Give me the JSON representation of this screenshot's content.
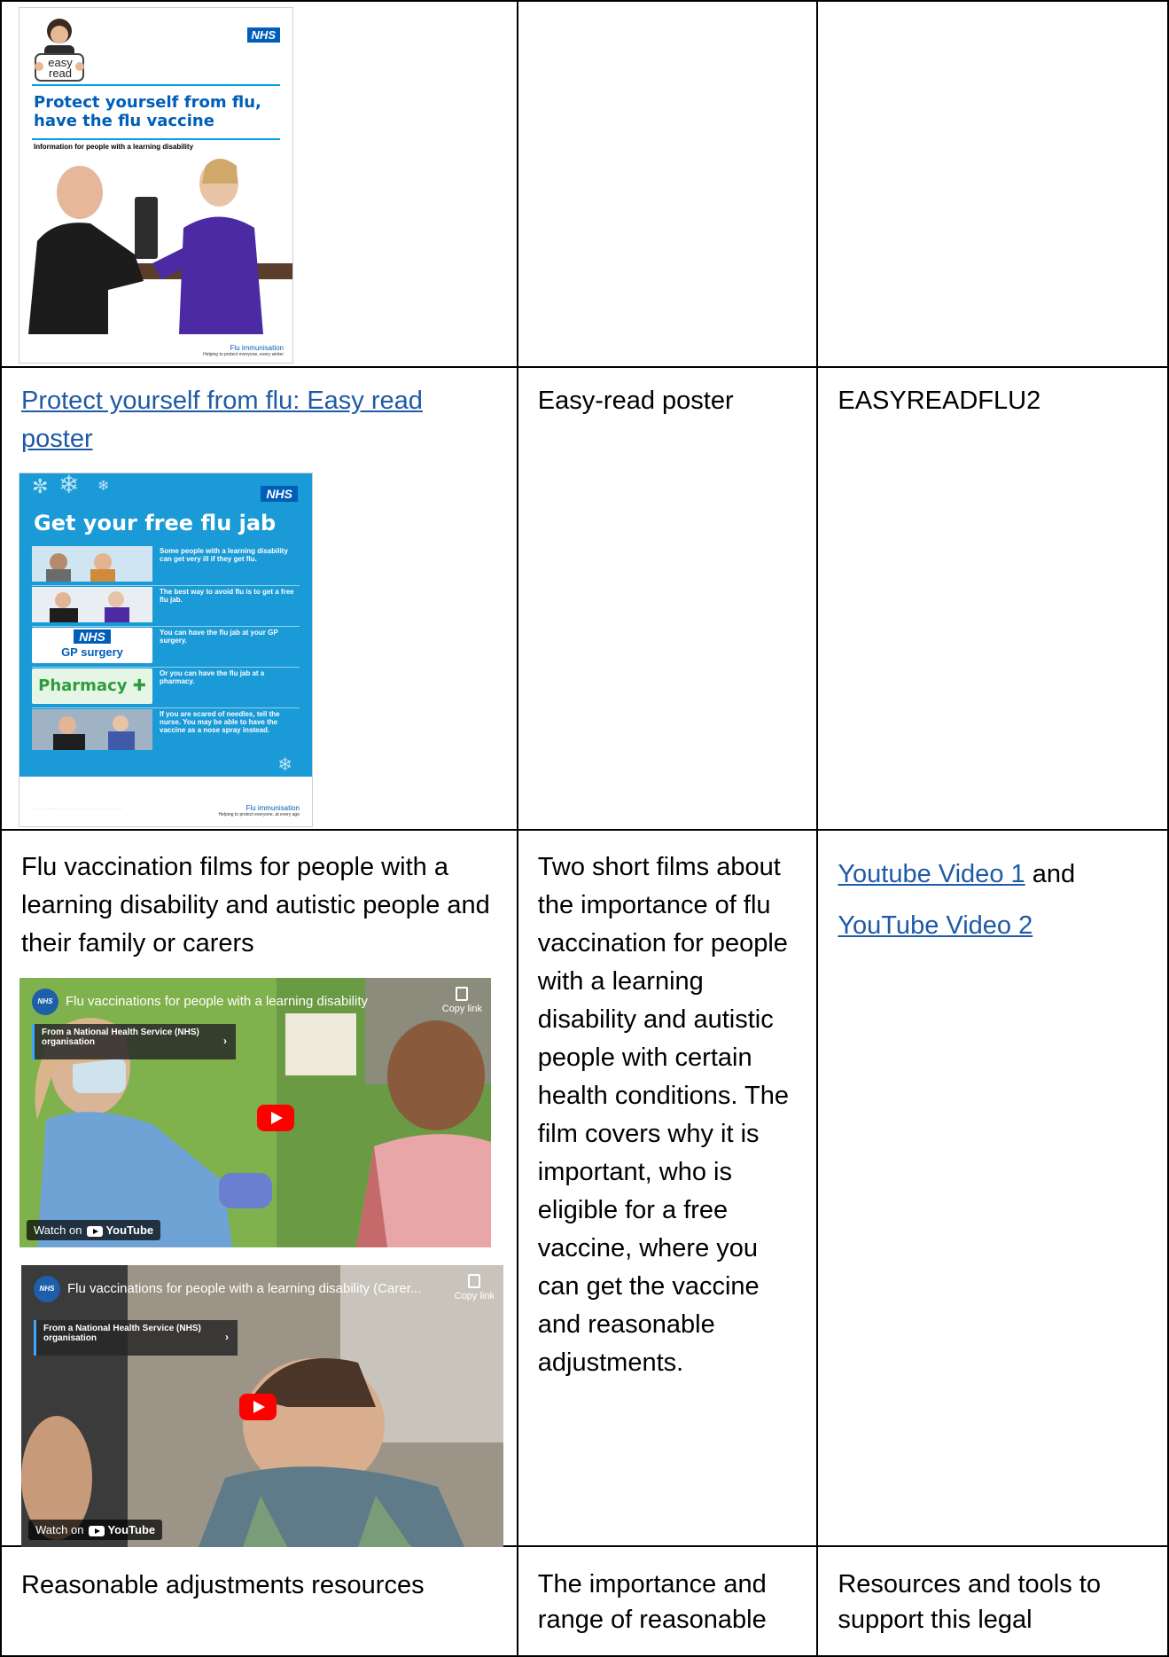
{
  "row1": {
    "cover": {
      "nhs_logo": "NHS",
      "easy_read_badge": "easy read",
      "title": "Protect yourself from flu, have the flu vaccine",
      "subtitle": "Information for people with a learning disability",
      "footer_brand": "Flu immunisation",
      "footer_tagline": "Helping to protect everyone, every winter"
    }
  },
  "row2": {
    "link_text": "Protect yourself from flu: Easy read poster",
    "type": "Easy-read poster",
    "code": "EASYREADFLU2",
    "poster": {
      "nhs_logo": "NHS",
      "title": "Get your free flu jab",
      "rows": [
        "Some people with a learning disability can get very ill if they get flu.",
        "The best way to avoid flu is to get a free flu jab.",
        "You can have the flu jab at your GP surgery.",
        "Or you can have the flu jab at a pharmacy.",
        "If you are scared of needles, tell the nurse. You may be able to have the vaccine as a nose spray instead."
      ],
      "gp_logo": "NHS",
      "gp_label": "GP surgery",
      "pharmacy_label": "Pharmacy",
      "footer_brand": "Flu immunisation",
      "footer_tagline": "Helping to protect everyone, at every age"
    }
  },
  "row3": {
    "title": "Flu vaccination films for people with a learning disability and autistic people and their family or carers",
    "description": "Two short films about the importance of flu vaccination for people with a learning disability and autistic people with certain health conditions. The film covers why it is important, who is eligible for a free vaccine, where you can get the vaccine and reasonable adjustments.",
    "link1": "Youtube Video 1",
    "and_word": "and",
    "link2": "YouTube Video 2",
    "video1": {
      "channel": "NHS",
      "title": "Flu vaccinations for people with a learning disability",
      "copy_link": "Copy link",
      "banner": "From a National Health Service (NHS) organisation",
      "watch_on": "Watch on",
      "youtube": "YouTube"
    },
    "video2": {
      "channel": "NHS",
      "title": "Flu vaccinations for people with a learning disability (Carer...",
      "copy_link": "Copy link",
      "banner": "From a National Health Service (NHS) organisation",
      "watch_on": "Watch on",
      "youtube": "YouTube"
    }
  },
  "row4": {
    "col1": "Reasonable adjustments resources",
    "col2": "The importance and range of reasonable",
    "col3": "Resources and tools to support this legal"
  }
}
